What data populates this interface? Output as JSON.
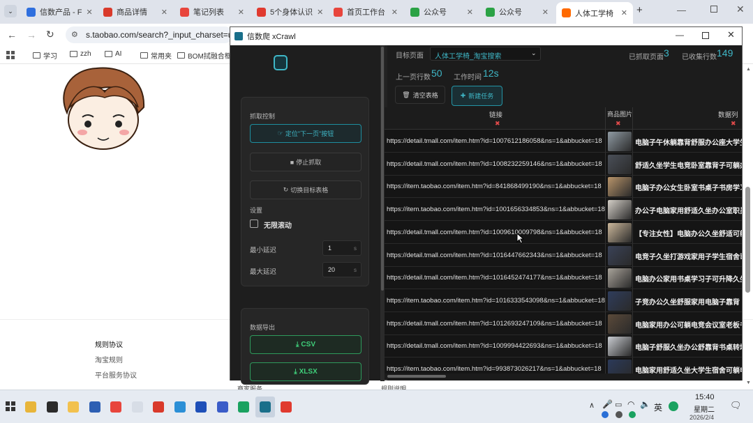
{
  "browser": {
    "tabs": [
      {
        "label": "信数产品 - F",
        "color": "#2f6fde"
      },
      {
        "label": "商品详情",
        "color": "#d93a2b"
      },
      {
        "label": "笔记列表",
        "color": "#e8453c"
      },
      {
        "label": "5个身体认识",
        "color": "#e03a2f"
      },
      {
        "label": "首页工作台",
        "color": "#e8453c"
      },
      {
        "label": "公众号",
        "color": "#2ba245"
      },
      {
        "label": "公众号",
        "color": "#2ba245"
      },
      {
        "label": "人体工学椅",
        "color": "#ff6a00"
      }
    ],
    "url": "s.taobao.com/search?_input_charset=u",
    "bookmarks": [
      "学习",
      "zzh",
      "AI",
      "常用夹",
      "BOM拭融合框"
    ]
  },
  "page": {
    "footer_links": [
      "规则协议",
      "淘宝规则",
      "平台服务协议"
    ],
    "bottom_partial": [
      "商家服务",
      "规则说明"
    ]
  },
  "app": {
    "title": "信数爬 xCrawl",
    "brand": "信数爬",
    "sidebar": {
      "capture_heading": "抓取控制",
      "locate_next": "定位\"下一页\"按钮",
      "stop": "停止抓取",
      "switch_table": "切换目标表格",
      "settings_heading": "设置",
      "infinite_scroll": "无限滚动",
      "min_delay_label": "最小延迟",
      "min_delay_value": "1",
      "max_delay_label": "最大延迟",
      "max_delay_value": "20",
      "unit": "s",
      "export_heading": "数据导出",
      "csv": "CSV",
      "xlsx": "XLSX"
    },
    "main": {
      "target_label": "目标页面",
      "target_value": "人体工学椅_淘宝搜索",
      "pages_label": "已抓取页面",
      "pages_value": "3",
      "rows_label": "已收集行数",
      "rows_value": "149",
      "prev_rows_label": "上一页行数",
      "prev_rows_value": "50",
      "work_time_label": "工作时间",
      "work_time_value": "12s",
      "clear_button": "清空表格",
      "new_task_button": "新建任务",
      "columns": [
        "链接",
        "商品图片",
        "数据列"
      ],
      "rows": [
        {
          "link": "https://detail.tmall.com/item.htm?id=1007612186058&ns=1&abbucket=18",
          "desc": "电脑子午休躺靠背舒服办公座大学生",
          "thumb": "#8f9aa3"
        },
        {
          "link": "https://detail.tmall.com/item.htm?id=1008232259146&ns=1&abbucket=18",
          "desc": "舒适久坐学生电竞卧室靠背子可躺办",
          "thumb": "#4a4f58"
        },
        {
          "link": "https://item.taobao.com/item.htm?id=841868499190&ns=1&abbucket=18",
          "desc": "电脑子办公女生卧室书桌子书房学习",
          "thumb": "#b8946a"
        },
        {
          "link": "https://item.taobao.com/item.htm?id=1001656334853&ns=1&abbucket=18",
          "desc": "办公子电脑家用舒适久坐办公室职员",
          "thumb": "#d4cfc7"
        },
        {
          "link": "https://detail.tmall.com/item.htm?id=1009610009798&ns=1&abbucket=18",
          "desc": "【专注女性】电脑办公久坐舒适可躺",
          "thumb": "#cbb79a"
        },
        {
          "link": "https://detail.tmall.com/item.htm?id=1016447662343&ns=1&abbucket=18",
          "desc": "电竞子久坐打游戏家用子学生宿舍司",
          "thumb": "#3a4257"
        },
        {
          "link": "https://detail.tmall.com/item.htm?id=1016452474177&ns=1&abbucket=18",
          "desc": "电脑办公家用书桌学习子可升降久坐",
          "thumb": "#a9a39a"
        },
        {
          "link": "https://item.taobao.com/item.htm?id=1016333543098&ns=1&abbucket=18",
          "desc": "子竞办公久坐舒服家用电脑子靠背",
          "thumb": "#2f3d5c"
        },
        {
          "link": "https://detail.tmall.com/item.htm?id=1012693247109&ns=1&abbucket=18",
          "desc": "电脑家用办公可躺电竞会议室老板书",
          "thumb": "#5b4a3a"
        },
        {
          "link": "https://detail.tmall.com/item.htm?id=1009994422693&ns=1&abbucket=18",
          "desc": "电脑子舒服久坐办公舒靠背书桌转培",
          "thumb": "#c9ccd1"
        },
        {
          "link": "https://item.taobao.com/item.htm?id=993873026217&ns=1&abbucket=18",
          "desc": "电脑家用舒适久坐大学生宿舍可躺电",
          "thumb": "#2b3a5a"
        }
      ]
    }
  },
  "taskbar": {
    "time": "15:40",
    "weekday": "星期二",
    "date": "2026/2/4",
    "ime": "英"
  }
}
